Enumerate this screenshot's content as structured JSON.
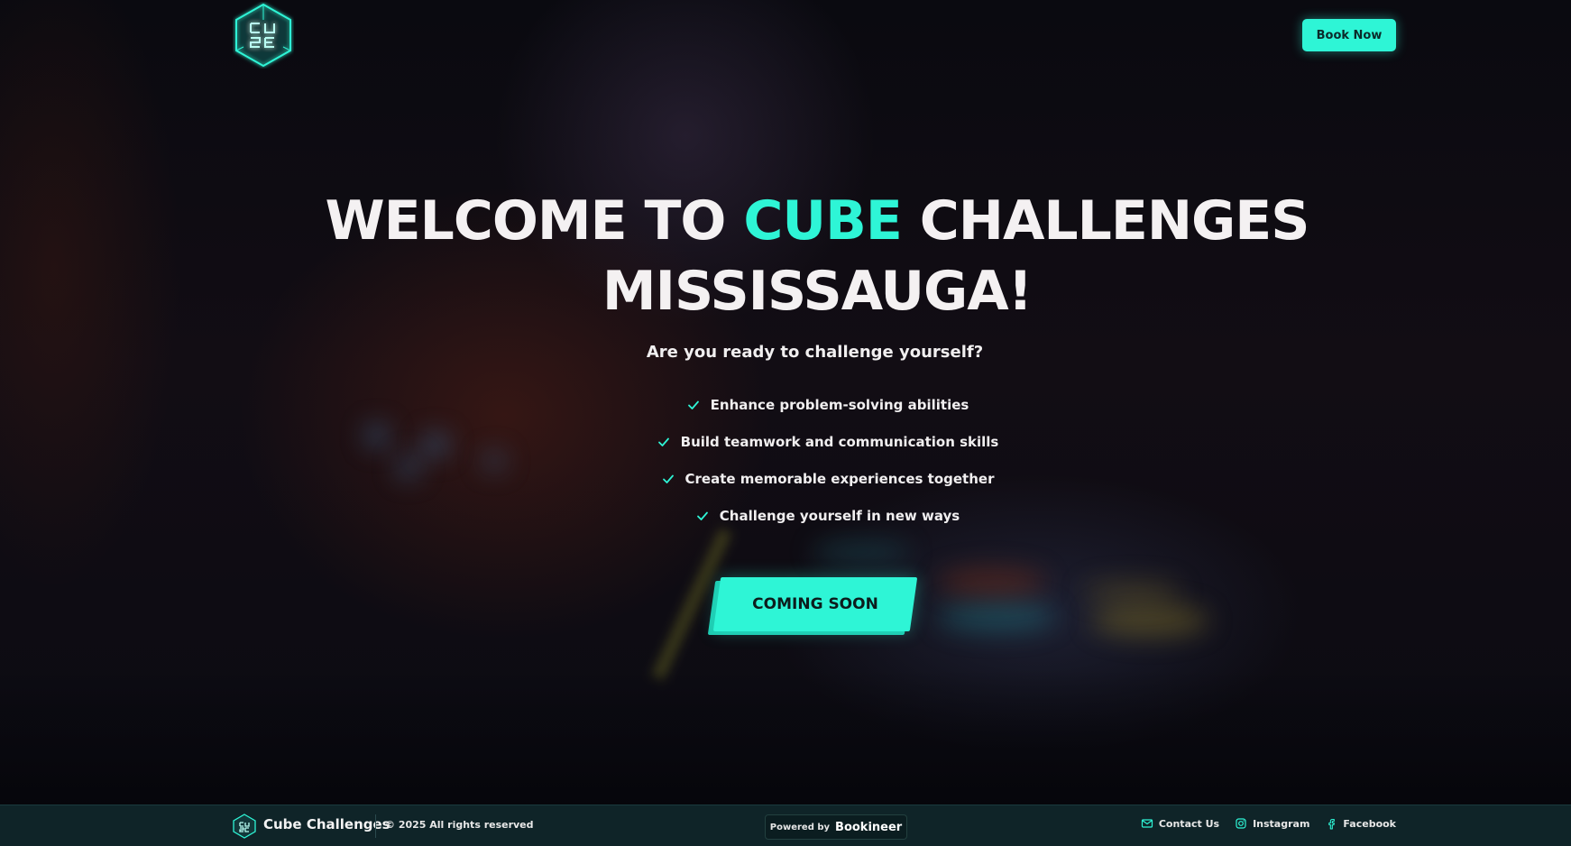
{
  "colors": {
    "accent": "#2ef5d6",
    "footer_bg": "#0f2428"
  },
  "header": {
    "logo_icon": "cube-logo-icon",
    "book_label": "Book Now"
  },
  "hero": {
    "title_part1": "WELCOME TO ",
    "title_accent": "CUBE",
    "title_part2": " CHALLENGES",
    "title_line2": "MISSISSAUGA!",
    "subtitle": "Are you ready to challenge yourself?",
    "features": [
      "Enhance problem-solving abilities",
      "Build teamwork and communication skills",
      "Create memorable experiences together",
      "Challenge yourself in new ways"
    ],
    "cta_label": "COMING SOON"
  },
  "footer": {
    "brand": "Cube Challenges",
    "copyright": "© 2025 All rights reserved",
    "powered_prefix": "Powered by",
    "powered_brand": "Bookineer",
    "links": [
      {
        "label": "Contact Us",
        "icon": "mail-icon"
      },
      {
        "label": "Instagram",
        "icon": "instagram-icon"
      },
      {
        "label": "Facebook",
        "icon": "facebook-icon"
      }
    ]
  }
}
